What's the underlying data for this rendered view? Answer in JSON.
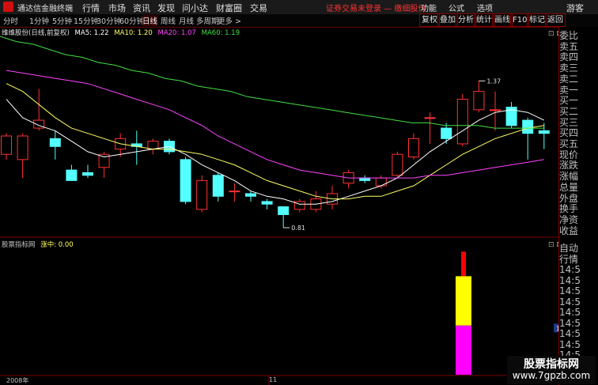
{
  "window": {
    "app_name": "通达信金融终端",
    "notice": "证券交易未登录 — 缴细股份",
    "guest": "游客"
  },
  "menu": [
    "行情",
    "市场",
    "资讯",
    "发现",
    "问小达",
    "财富圈",
    "交易"
  ],
  "right_menu": [
    "功能",
    "公式",
    "选项"
  ],
  "periods": [
    "分时",
    "1分钟",
    "5分钟",
    "15分钟",
    "30分钟",
    "60分钟",
    "日线",
    "周线",
    "月线",
    "多周期",
    "更多 >"
  ],
  "active_period": "日线",
  "tools": [
    "复权",
    "叠加",
    "分析",
    "统计",
    "画线",
    "F10",
    "标记",
    "返回"
  ],
  "main_legend": {
    "title": "维维股份(日线,前复权)",
    "ma5": "MA5: 1.22",
    "ma10": "MA10: 1.20",
    "ma20": "MA20: 1.07",
    "ma60": "MA60: 1.19"
  },
  "sub_legend": {
    "name": "股票指标网",
    "field": "涨中: 0.00"
  },
  "right_panel": [
    "委比",
    "卖五",
    "卖四",
    "卖三",
    "卖二",
    "卖一",
    "买一",
    "买二",
    "买三",
    "买四",
    "买五",
    "现价",
    "涨跌",
    "涨幅",
    "总量",
    "外盘",
    "换手",
    "净资",
    "收益"
  ],
  "right_panel_bottom": [
    "自动",
    "行情",
    "14:5",
    "14:5",
    "14:5",
    "14:5",
    "14:5",
    "14:5",
    "14:5",
    "14:5",
    "14:5",
    "14:5",
    "14:5"
  ],
  "axis_labels": {
    "year": "2008年",
    "month": "11"
  },
  "watermark": {
    "line1": "股票指标网",
    "line2": "www.7gpzb.com"
  },
  "colors": {
    "up": "#ff3232",
    "down": "#54ffff",
    "ma5": "#ffffff",
    "ma10": "#ffff66",
    "ma20": "#ff44ff",
    "ma60": "#44dd44",
    "bar_red": "#ff0000",
    "bar_yellow": "#ffff00",
    "bar_magenta": "#ff00ff"
  },
  "chart_data": [
    {
      "type": "candlestick",
      "title": "维维股份(日线,前复权)",
      "yticks": [
        1.5,
        1.4,
        1.3,
        1.2,
        1.1,
        1.0,
        0.9,
        0.8
      ],
      "ylim": [
        0.78,
        1.54
      ],
      "annotations": [
        {
          "text": "1.37",
          "value": 1.37
        },
        {
          "text": "0.81",
          "value": 0.81
        }
      ],
      "candles": [
        {
          "o": 1.09,
          "c": 1.16,
          "h": 1.17,
          "l": 1.07
        },
        {
          "o": 1.07,
          "c": 1.16,
          "h": 1.17,
          "l": 1.0
        },
        {
          "o": 1.19,
          "c": 1.22,
          "h": 1.34,
          "l": 1.18
        },
        {
          "o": 1.15,
          "c": 1.12,
          "h": 1.18,
          "l": 1.07
        },
        {
          "o": 1.03,
          "c": 0.99,
          "h": 1.05,
          "l": 0.99
        },
        {
          "o": 1.02,
          "c": 1.01,
          "h": 1.05,
          "l": 1.0
        },
        {
          "o": 1.04,
          "c": 1.09,
          "h": 1.1,
          "l": 1.0
        },
        {
          "o": 1.11,
          "c": 1.15,
          "h": 1.17,
          "l": 1.08
        },
        {
          "o": 1.13,
          "c": 1.12,
          "h": 1.18,
          "l": 1.05
        },
        {
          "o": 1.11,
          "c": 1.14,
          "h": 1.15,
          "l": 1.09
        },
        {
          "o": 1.14,
          "c": 1.1,
          "h": 1.15,
          "l": 1.09
        },
        {
          "o": 1.07,
          "c": 0.91,
          "h": 1.08,
          "l": 0.9
        },
        {
          "o": 0.88,
          "c": 0.99,
          "h": 1.01,
          "l": 0.87
        },
        {
          "o": 1.01,
          "c": 0.93,
          "h": 1.02,
          "l": 0.91
        },
        {
          "o": 0.95,
          "c": 0.95,
          "h": 0.98,
          "l": 0.91
        },
        {
          "o": 0.94,
          "c": 0.93,
          "h": 0.95,
          "l": 0.91
        },
        {
          "o": 0.91,
          "c": 0.9,
          "h": 0.92,
          "l": 0.88
        },
        {
          "o": 0.89,
          "c": 0.86,
          "h": 0.89,
          "l": 0.81
        },
        {
          "o": 0.88,
          "c": 0.91,
          "h": 0.92,
          "l": 0.87
        },
        {
          "o": 0.88,
          "c": 0.92,
          "h": 0.95,
          "l": 0.87
        },
        {
          "o": 0.9,
          "c": 0.94,
          "h": 0.97,
          "l": 0.88
        },
        {
          "o": 0.98,
          "c": 1.02,
          "h": 1.03,
          "l": 0.96
        },
        {
          "o": 1.0,
          "c": 0.99,
          "h": 1.01,
          "l": 0.98
        },
        {
          "o": 0.97,
          "c": 1.0,
          "h": 1.01,
          "l": 0.96
        },
        {
          "o": 1.01,
          "c": 1.09,
          "h": 1.1,
          "l": 1.0
        },
        {
          "o": 1.08,
          "c": 1.15,
          "h": 1.17,
          "l": 1.07
        },
        {
          "o": 1.23,
          "c": 1.23,
          "h": 1.25,
          "l": 1.13
        },
        {
          "o": 1.19,
          "c": 1.15,
          "h": 1.21,
          "l": 1.13
        },
        {
          "o": 1.13,
          "c": 1.3,
          "h": 1.32,
          "l": 1.12
        },
        {
          "o": 1.26,
          "c": 1.33,
          "h": 1.37,
          "l": 1.25
        },
        {
          "o": 1.26,
          "c": 1.26,
          "h": 1.33,
          "l": 1.18
        },
        {
          "o": 1.27,
          "c": 1.2,
          "h": 1.29,
          "l": 1.19
        },
        {
          "o": 1.22,
          "c": 1.17,
          "h": 1.23,
          "l": 1.07
        },
        {
          "o": 1.18,
          "c": 1.17,
          "h": 1.21,
          "l": 1.11
        }
      ],
      "series": [
        {
          "name": "MA5",
          "values": [
            1.3,
            1.23,
            1.2,
            1.18,
            1.14,
            1.1,
            1.08,
            1.09,
            1.1,
            1.11,
            1.12,
            1.09,
            1.05,
            1.02,
            0.99,
            0.95,
            0.93,
            0.92,
            0.9,
            0.9,
            0.91,
            0.93,
            0.95,
            0.97,
            1.0,
            1.05,
            1.1,
            1.14,
            1.18,
            1.22,
            1.25,
            1.26,
            1.25,
            1.22
          ]
        },
        {
          "name": "MA10",
          "values": [
            1.36,
            1.33,
            1.28,
            1.23,
            1.19,
            1.17,
            1.15,
            1.13,
            1.12,
            1.11,
            1.11,
            1.1,
            1.09,
            1.07,
            1.05,
            1.02,
            0.99,
            0.97,
            0.95,
            0.93,
            0.92,
            0.92,
            0.93,
            0.93,
            0.95,
            0.97,
            1.01,
            1.05,
            1.09,
            1.12,
            1.15,
            1.17,
            1.19,
            1.2
          ]
        },
        {
          "name": "MA20",
          "values": [
            1.41,
            1.4,
            1.39,
            1.38,
            1.37,
            1.36,
            1.34,
            1.32,
            1.3,
            1.28,
            1.26,
            1.23,
            1.2,
            1.16,
            1.13,
            1.1,
            1.07,
            1.05,
            1.03,
            1.02,
            1.01,
            1.0,
            1.0,
            1.0,
            1.0,
            1.0,
            1.01,
            1.01,
            1.02,
            1.03,
            1.04,
            1.05,
            1.06,
            1.07
          ]
        },
        {
          "name": "MA60",
          "values": [
            1.54,
            1.52,
            1.51,
            1.49,
            1.47,
            1.46,
            1.44,
            1.43,
            1.41,
            1.4,
            1.38,
            1.37,
            1.35,
            1.34,
            1.33,
            1.31,
            1.3,
            1.29,
            1.28,
            1.27,
            1.26,
            1.25,
            1.24,
            1.23,
            1.22,
            1.21,
            1.21,
            1.2,
            1.2,
            1.2,
            1.19,
            1.19,
            1.19,
            1.19
          ]
        }
      ]
    },
    {
      "type": "bar",
      "title": "股票指标网",
      "yticks": [
        3.0,
        2.5,
        2.0,
        1.5,
        1.0
      ],
      "ylim": [
        0.5,
        3.1
      ],
      "current_value_label": "1.44",
      "stacked_bar": [
        {
          "from": 0.5,
          "to": 1.5,
          "color": "#ff00ff"
        },
        {
          "from": 1.5,
          "to": 2.5,
          "color": "#ffff00"
        },
        {
          "from": 2.5,
          "to": 3.0,
          "color": "#ff0000"
        }
      ]
    }
  ]
}
